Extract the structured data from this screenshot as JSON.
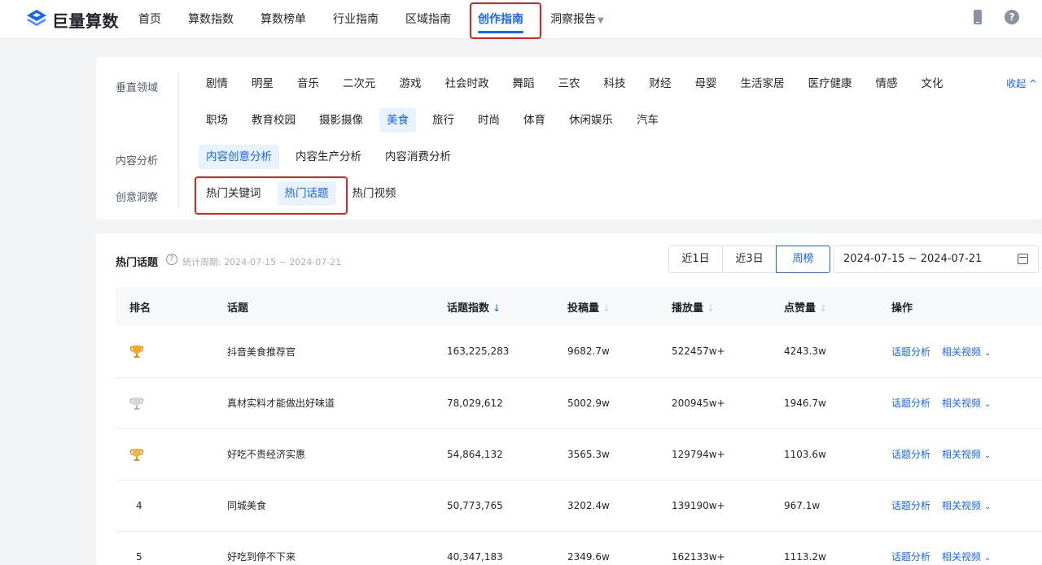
{
  "brand": {
    "name": "巨量算数",
    "accent": "#1664ff",
    "highlight": "#e02020"
  },
  "nav": {
    "items": [
      {
        "label": "首页"
      },
      {
        "label": "算数指数"
      },
      {
        "label": "算数榜单"
      },
      {
        "label": "行业指南"
      },
      {
        "label": "区域指南"
      },
      {
        "label": "创作指南",
        "active": true
      },
      {
        "label": "洞察报告",
        "dropdown": true
      }
    ],
    "icons": [
      "phone-icon",
      "help-icon"
    ],
    "help_glyph": "?"
  },
  "filters": {
    "vertical_label": "垂直领域",
    "verticals_row1": [
      "剧情",
      "明星",
      "音乐",
      "二次元",
      "游戏",
      "社会时政",
      "舞蹈",
      "三农",
      "科技",
      "财经",
      "母婴",
      "生活家居",
      "医疗健康",
      "情感",
      "文化"
    ],
    "verticals_row2": [
      "职场",
      "教育校园",
      "摄影摄像",
      "美食",
      "旅行",
      "时尚",
      "体育",
      "休闲娱乐",
      "汽车"
    ],
    "vertical_selected": "美食",
    "collapse_label": "收起 ^",
    "content_label": "内容分析",
    "content_tabs": [
      "内容创意分析",
      "内容生产分析",
      "内容消费分析"
    ],
    "content_selected": "内容创意分析",
    "insight_label": "创意洞察",
    "insight_tabs": [
      "热门关键词",
      "热门话题",
      "热门视频"
    ],
    "insight_selected": "热门话题"
  },
  "panel": {
    "title": "热门话题",
    "period": "统计周期: 2024-07-15 ~ 2024-07-21",
    "ranges": [
      "近1日",
      "近3日",
      "周榜"
    ],
    "range_selected": "周榜",
    "date_range": "2024-07-15 ~ 2024-07-21",
    "columns": {
      "rank": "排名",
      "topic": "话题",
      "index": "话题指数",
      "posts": "投稿量",
      "plays": "播放量",
      "likes": "点赞量",
      "ops": "操作"
    },
    "sort_glyph": "↓",
    "op_analysis": "话题分析",
    "op_videos": "相关视频",
    "rows": [
      {
        "rank": "1",
        "medal": "gold",
        "topic": "抖音美食推荐官",
        "index": "163,225,283",
        "posts": "9682.7w",
        "plays": "522457w+",
        "likes": "4243.3w"
      },
      {
        "rank": "2",
        "medal": "silver",
        "topic": "真材实料才能做出好味道",
        "index": "78,029,612",
        "posts": "5002.9w",
        "plays": "200945w+",
        "likes": "1946.7w"
      },
      {
        "rank": "3",
        "medal": "bronze",
        "topic": "好吃不贵经济实惠",
        "index": "54,864,132",
        "posts": "3565.3w",
        "plays": "129794w+",
        "likes": "1103.6w"
      },
      {
        "rank": "4",
        "medal": "",
        "topic": "同城美食",
        "index": "50,773,765",
        "posts": "3202.4w",
        "plays": "139190w+",
        "likes": "967.1w"
      },
      {
        "rank": "5",
        "medal": "",
        "topic": "好吃到停不下来",
        "index": "40,347,183",
        "posts": "2349.6w",
        "plays": "162133w+",
        "likes": "1113.2w"
      }
    ]
  }
}
